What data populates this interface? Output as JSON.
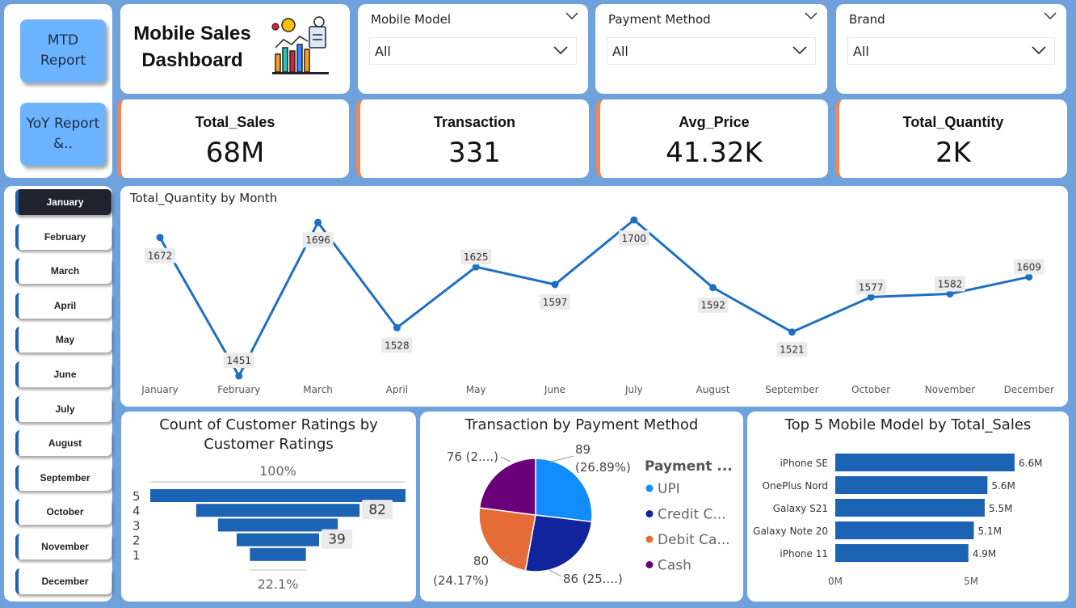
{
  "nav": {
    "mtd": "MTD Report",
    "yoy": "YoY Report &.."
  },
  "title": {
    "line1": "Mobile Sales",
    "line2": "Dashboard"
  },
  "slicers": [
    {
      "label": "Mobile Model",
      "value": "All"
    },
    {
      "label": "Payment Method",
      "value": "All"
    },
    {
      "label": "Brand",
      "value": "All"
    }
  ],
  "kpis": [
    {
      "label": "Total_Sales",
      "value": "68M"
    },
    {
      "label": "Transaction",
      "value": "331"
    },
    {
      "label": "Avg_Price",
      "value": "41.32K"
    },
    {
      "label": "Total_Quantity",
      "value": "2K"
    }
  ],
  "months": [
    "January",
    "February",
    "March",
    "April",
    "May",
    "June",
    "July",
    "August",
    "September",
    "October",
    "November",
    "December"
  ],
  "active_month": "January",
  "colors": {
    "accent": "#1d63b4",
    "kpi_edge": "#f0855a",
    "background": "#6fa1dc",
    "line": "#1f6fc4"
  },
  "chart_data": [
    {
      "type": "line",
      "title": "Total_Quantity by Month",
      "x": [
        "January",
        "February",
        "March",
        "April",
        "May",
        "June",
        "July",
        "August",
        "September",
        "October",
        "November",
        "December"
      ],
      "values": [
        1672,
        1451,
        1696,
        1528,
        1625,
        1597,
        1700,
        1592,
        1521,
        1577,
        1582,
        1609
      ],
      "ylim": [
        1451,
        1700
      ]
    },
    {
      "type": "bar",
      "subtype": "funnel",
      "title": "Count of Customer Ratings by Customer Ratings",
      "categories": [
        "5",
        "4",
        "3",
        "2",
        "1"
      ],
      "values": [
        164,
        105,
        77,
        53,
        36
      ],
      "labels": {
        "4": "82",
        "2": "39"
      },
      "top_label": "100%",
      "bottom_label": "22.1%"
    },
    {
      "type": "pie",
      "title": "Transaction by Payment Method",
      "legend_title": "Payment ...",
      "categories": [
        "UPI",
        "Credit C...",
        "Debit Ca...",
        "Cash"
      ],
      "values": [
        89,
        86,
        80,
        76
      ],
      "colors": [
        "#118dff",
        "#12239e",
        "#e66c37",
        "#6b007b"
      ],
      "slice_labels": [
        "89",
        "(26.89%)",
        "86 (25....)",
        "80",
        "(24.17%)",
        "76 (2....)"
      ]
    },
    {
      "type": "bar",
      "orientation": "horizontal",
      "title": "Top 5 Mobile Model by Total_Sales",
      "categories": [
        "iPhone SE",
        "OnePlus Nord",
        "Galaxy S21",
        "Galaxy Note 20",
        "iPhone 11"
      ],
      "values": [
        6.6,
        5.6,
        5.5,
        5.1,
        4.9
      ],
      "value_labels": [
        "6.6M",
        "5.6M",
        "5.5M",
        "5.1M",
        "4.9M"
      ],
      "xticks": [
        "0M",
        "5M"
      ]
    }
  ]
}
